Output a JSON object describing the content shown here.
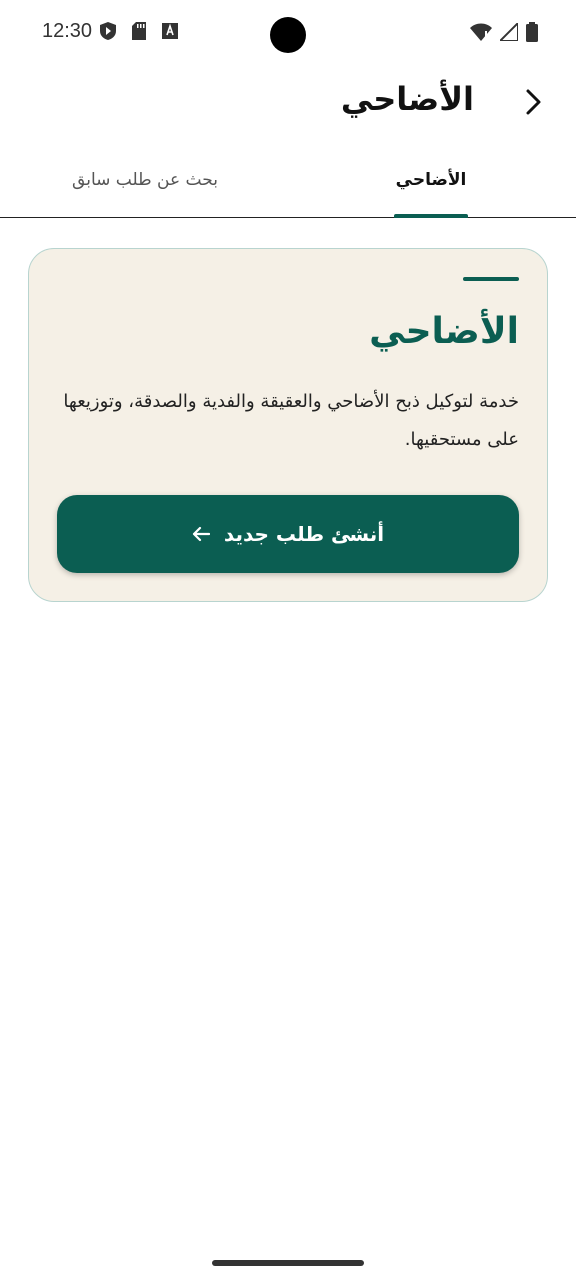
{
  "status_bar": {
    "time": "12:30",
    "left_icons": [
      "shield-play-icon",
      "sd-card-icon",
      "font-a-icon"
    ],
    "right_icons": [
      "wifi-icon",
      "signal-icon",
      "battery-icon"
    ]
  },
  "app_bar": {
    "title": "الأضاحي",
    "back_icon": "chevron-right-icon"
  },
  "tabs": [
    {
      "label": "الأضاحي",
      "active": true
    },
    {
      "label": "بحث عن طلب سابق",
      "active": false
    }
  ],
  "card": {
    "title": "الأضاحي",
    "description": "خدمة لتوكيل ذبح الأضاحي والعقيقة والفدية والصدقة، وتوزيعها على مستحقيها.",
    "button_label": "أنشئ طلب جديد",
    "button_icon": "arrow-left-icon"
  },
  "colors": {
    "primary": "#0b5e52",
    "card_background": "#f5f0e6",
    "card_border": "#b8d4cf"
  }
}
